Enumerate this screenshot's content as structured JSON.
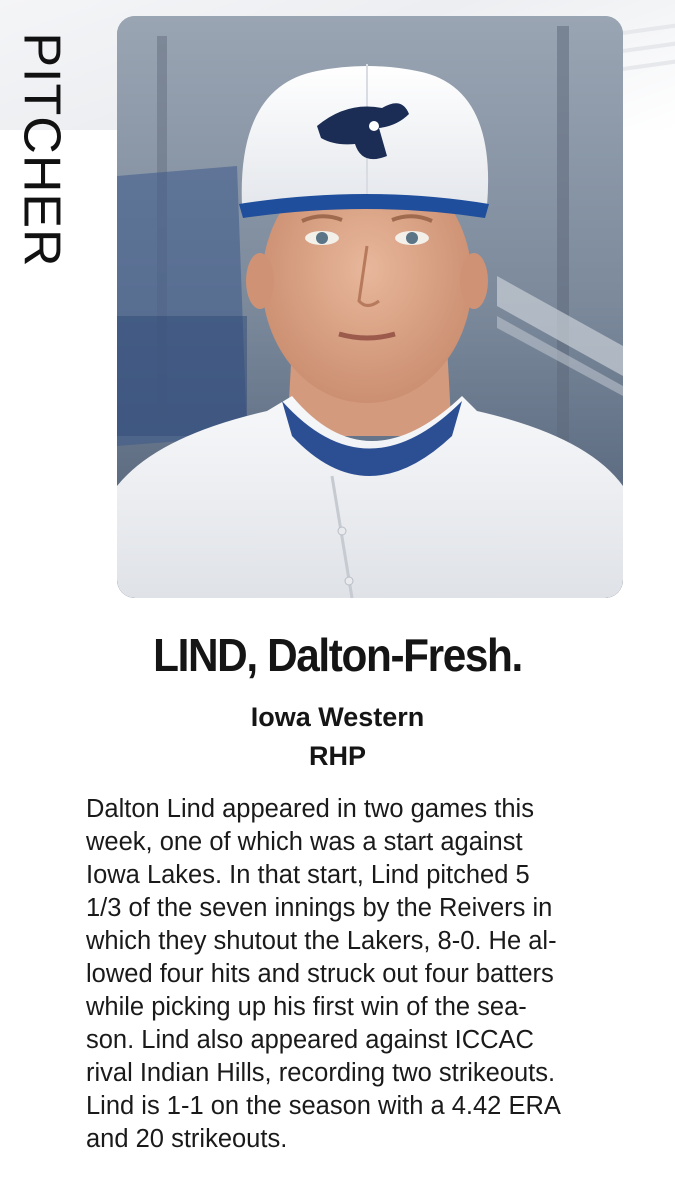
{
  "position_label": "PITCHER",
  "photo": {
    "subject": "player-headshot",
    "cap_logo": "reivers-pirate-logo"
  },
  "player": {
    "name": "LIND, Dalton-Fresh.",
    "school": "Iowa Western",
    "position": "RHP"
  },
  "bio_lines": [
    "Dalton Lind appeared in two games this",
    "week, one of which was a start against",
    "Iowa Lakes. In that start, Lind pitched 5",
    "1/3 of the seven innings by the Reivers in",
    "which they shutout the Lakers, 8-0. He al-",
    "lowed four hits and struck out four batters",
    "while picking up his first win of the sea-",
    "son. Lind also appeared against ICCAC",
    "rival Indian Hills, recording two strikeouts.",
    "Lind is 1-1 on the season with a 4.42 ERA",
    "and 20 strikeouts."
  ],
  "colors": {
    "cap_brim": "#1f4e9c",
    "jersey": "#f2f3f5",
    "background_sky": "#8a96a6"
  }
}
